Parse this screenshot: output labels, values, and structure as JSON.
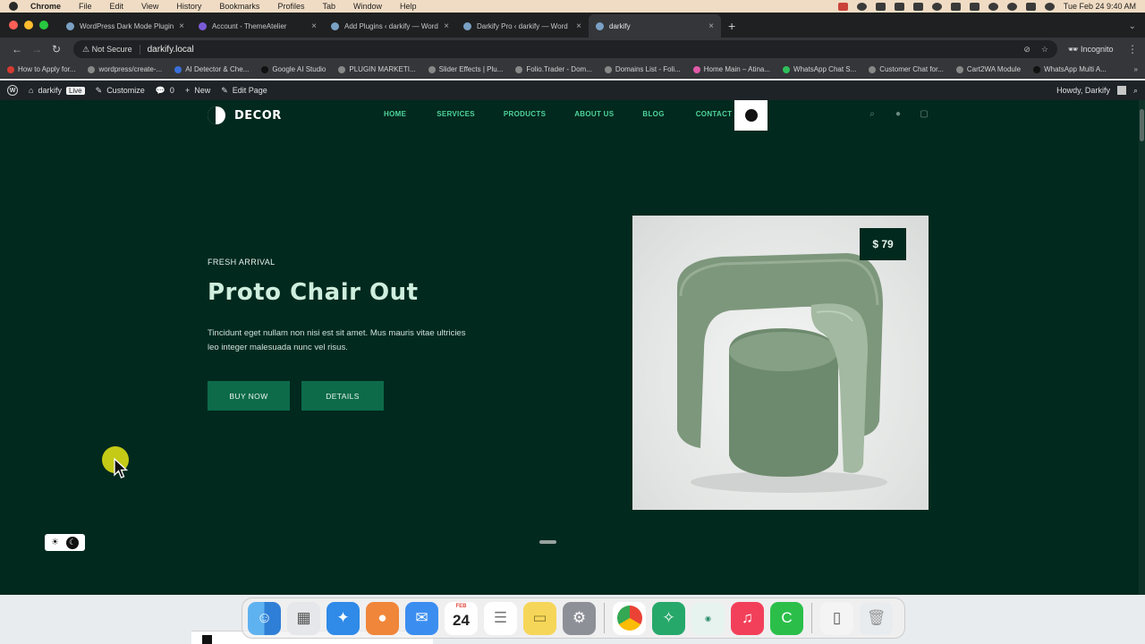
{
  "menubar": {
    "app": "Chrome",
    "items": [
      "File",
      "Edit",
      "View",
      "History",
      "Bookmarks",
      "Profiles",
      "Tab",
      "Window",
      "Help"
    ],
    "datetime": "Tue Feb 24  9:40 AM"
  },
  "tabs": [
    {
      "title": "WordPress Dark Mode Plugin",
      "color": "#5b8bd6"
    },
    {
      "title": "Account - ThemeAtelier",
      "color": "#7a5bd6"
    },
    {
      "title": "Add Plugins ‹ darkify — Word",
      "color": "#4a7fb5"
    },
    {
      "title": "Darkify Pro ‹ darkify — Word",
      "color": "#4a7fb5"
    },
    {
      "title": "darkify",
      "color": "#4a7fb5"
    }
  ],
  "address": {
    "secure_label": "Not Secure",
    "url": "darkify.local",
    "incognito_label": "Incognito"
  },
  "bookmarks": [
    {
      "label": "How to Apply for...",
      "color": "#d63b33"
    },
    {
      "label": "wordpress/create-...",
      "color": "#aaaaaa"
    },
    {
      "label": "AI Detector & Che...",
      "color": "#3a6fd8"
    },
    {
      "label": "Google AI Studio",
      "color": "#222222"
    },
    {
      "label": "PLUGIN MARKETI...",
      "color": "#aaaaaa"
    },
    {
      "label": "Slider Effects | Plu...",
      "color": "#aaaaaa"
    },
    {
      "label": "Folio.Trader - Dom...",
      "color": "#aaaaaa"
    },
    {
      "label": "Domains List - Foli...",
      "color": "#aaaaaa"
    },
    {
      "label": "Home Main – Atina...",
      "color": "#e05aa8"
    },
    {
      "label": "WhatsApp Chat S...",
      "color": "#2fbf5a"
    },
    {
      "label": "Customer Chat for...",
      "color": "#aaaaaa"
    },
    {
      "label": "Cart2WA Module",
      "color": "#aaaaaa"
    },
    {
      "label": "WhatsApp Multi A...",
      "color": "#111111"
    }
  ],
  "wpbar": {
    "site_name": "darkify",
    "live_badge": "Live",
    "customize": "Customize",
    "comments_count": "0",
    "new_label": "New",
    "edit_page": "Edit Page",
    "howdy": "Howdy, Darkify"
  },
  "site": {
    "logo_text": "DECOR",
    "nav": [
      "HOME",
      "SERVICES",
      "PRODUCTS",
      "ABOUT US",
      "BLOG",
      "CONTACT"
    ],
    "hero": {
      "eyebrow": "FRESH ARRIVAL",
      "title": "Proto Chair Out",
      "description": "Tincidunt eget nullam non nisi est sit amet. Mus mauris vitae ultricies leo integer malesuada nunc vel risus.",
      "buy_label": "BUY NOW",
      "details_label": "DETAILS",
      "price": "$ 79"
    }
  },
  "dock": {
    "calendar_month": "FEB",
    "calendar_day": "24"
  },
  "colors": {
    "site_bg": "#01291e",
    "accent": "#0d6b4a",
    "nav_link": "#4fd39a",
    "chair": "#7f9a7f"
  }
}
